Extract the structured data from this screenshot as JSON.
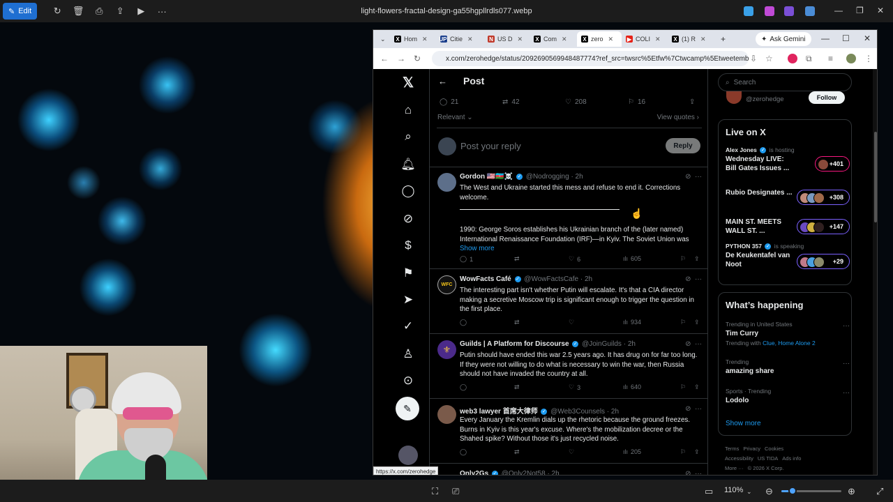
{
  "viewer": {
    "edit_label": "Edit",
    "filename": "light-flowers-fractal-design-ga55hgpllrdls077.webp",
    "zoom": "110%"
  },
  "browser": {
    "tabs": [
      {
        "label": "Hom",
        "icon": "x-logo-icon",
        "fav": "X",
        "color": "#000000"
      },
      {
        "label": "Citie",
        "icon": "upi-icon",
        "fav": "UPI",
        "color": "#1a3e8c"
      },
      {
        "label": "US D",
        "icon": "news-icon",
        "fav": "N",
        "color": "#c0392b"
      },
      {
        "label": "Com",
        "icon": "x-logo-icon",
        "fav": "X",
        "color": "#000000"
      },
      {
        "label": "zero",
        "icon": "x-logo-icon",
        "fav": "X",
        "color": "#000000",
        "active": true
      },
      {
        "label": "COLI",
        "icon": "youtube-icon",
        "fav": "▶",
        "color": "#e62117"
      },
      {
        "label": "(1) R",
        "icon": "x-logo-icon",
        "fav": "X",
        "color": "#000000"
      }
    ],
    "gemini_label": "Ask Gemini",
    "url": "x.com/zerohedge/status/2092690569948487774?ref_src=twsrc%5Etfw%7Ctwcamp%5Etweetembed%...",
    "status_url": "https://x.com/zerohedge"
  },
  "post": {
    "title": "Post",
    "stats": {
      "replies": "21",
      "reposts": "42",
      "likes": "208",
      "bookmarks": "16"
    },
    "sort_label": "Relevant",
    "view_quotes": "View quotes",
    "reply_placeholder": "Post your reply",
    "reply_button": "Reply"
  },
  "tweets": [
    {
      "name": "Gordon 🇺🇸🇦🇿☠️",
      "handle": "@Nodrogging · 2h",
      "avatar_color": "#5d6f8a",
      "text1": "The West and Ukraine started this mess and refuse to end it.  Corrections welcome.",
      "text2": "1990: George Soros establishes his Ukrainian branch of the (later named) International Renaissance Foundation (IRF)—in Kyiv. The Soviet Union was",
      "show_more": "Show more",
      "replies": "1",
      "reposts": "",
      "likes": "6",
      "views": "605"
    },
    {
      "name": "WowFacts Café",
      "handle": "@WowFactsCafe · 2h",
      "avatar_color": "#111111",
      "avatar_text": "WFC",
      "text1": "The interesting part isn't whether Putin will escalate. It's that a CIA director making a secretive Moscow trip is significant enough to trigger the question in the first place.",
      "replies": "",
      "reposts": "",
      "likes": "",
      "views": "934"
    },
    {
      "name": "Guilds | A Platform for Discourse",
      "handle": "@JoinGuilds · 2h",
      "avatar_color": "#4b2a8a",
      "text1": "Putin should have ended this war 2.5 years ago. It has drug on for far too long. If they were not willing to do what is necessary to win the war, then Russia should not have invaded the country at all.",
      "replies": "",
      "reposts": "",
      "likes": "3",
      "views": "640"
    },
    {
      "name": "web3 lawyer 首席大律师",
      "handle": "@Web3Counsels · 2h",
      "avatar_color": "#7a5a4a",
      "text1": "Every January the Kremlin dials up the rhetoric because the ground freezes. Burns in Kyiv is this year's excuse. Where's the mobilization decree or the Shahed spike? Without those it's just recycled noise.",
      "replies": "",
      "reposts": "",
      "likes": "",
      "views": "205"
    },
    {
      "name": "Only2Gs",
      "handle": "@Only2Not58 · 2h",
      "avatar_color": "#444444"
    }
  ],
  "sidebar": {
    "search_placeholder": "Search",
    "profile_handle": "@zerohedge",
    "follow_label": "Follow",
    "live_title": "Live on X",
    "live": [
      {
        "host": "Alex Jones",
        "status": "is hosting",
        "title": "Wednesday LIVE: Bill Gates Issues ...",
        "count": "+401",
        "accent": "#f91880"
      },
      {
        "host": "",
        "status": "",
        "title": "Rubio Designates ...",
        "count": "+308",
        "accent": "#7b61ff"
      },
      {
        "host": "",
        "status": "",
        "title": "MAIN ST. MEETS WALL ST. ...",
        "count": "+147",
        "accent": "#7b61ff"
      },
      {
        "host": "PYTHON 357",
        "status": "is speaking",
        "title": "De Keukentafel van Noot",
        "count": "+29",
        "accent": "#7b61ff"
      }
    ],
    "happening_title": "What’s happening",
    "trends": [
      {
        "context": "Trending in United States",
        "name": "Tim Curry",
        "extra_prefix": "Trending with",
        "extra_links": "Clue, Home Alone 2"
      },
      {
        "context": "Trending",
        "name": "amazing share",
        "extra_prefix": "",
        "extra_links": ""
      },
      {
        "context": "Sports · Trending",
        "name": "Lodolo",
        "extra_prefix": "",
        "extra_links": ""
      }
    ],
    "show_more": "Show more",
    "footer": [
      "Terms",
      "Privacy",
      "Cookies",
      "Accessibility",
      "US TIDA",
      "Ads info",
      "More ···",
      "© 2026 X Corp."
    ]
  }
}
